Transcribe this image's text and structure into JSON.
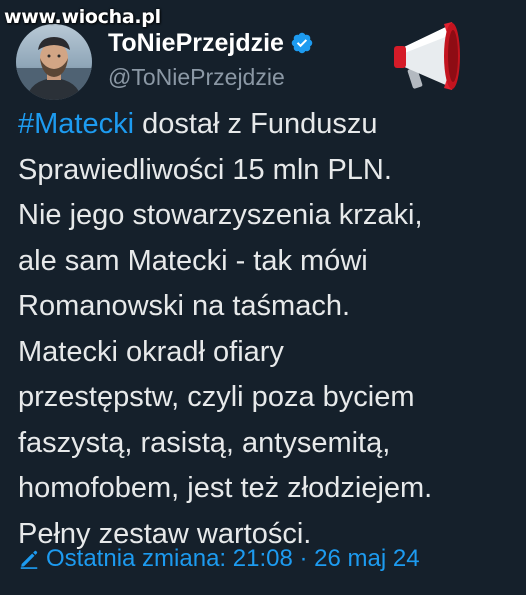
{
  "watermark": "www.wiocha.pl",
  "author": {
    "display_name": "ToNiePrzejdzie",
    "handle": "@ToNiePrzejdzie",
    "verified_icon": "verified-badge-icon",
    "extra_icon": "megaphone-icon"
  },
  "tweet": {
    "hashtag": "#Matecki",
    "lines": [
      " dostał z Funduszu",
      "Sprawiedliwości 15 mln PLN.",
      "Nie jego stowarzyszenia krzaki,",
      "ale sam Matecki - tak mówi",
      "Romanowski na taśmach.",
      "Matecki okradł ofiary",
      "przestępstw, czyli poza byciem",
      "faszystą, rasistą, antysemitą,",
      "homofobem, jest też złodziejem.",
      "Pełny zestaw wartości."
    ]
  },
  "edited": {
    "icon": "pencil-icon",
    "text": "Ostatnia zmiana: 21:08 · 26 maj 24"
  },
  "colors": {
    "background": "#15202b",
    "text": "#e7e9ea",
    "accent": "#1d9bf0",
    "secondary": "#8b98a5"
  }
}
